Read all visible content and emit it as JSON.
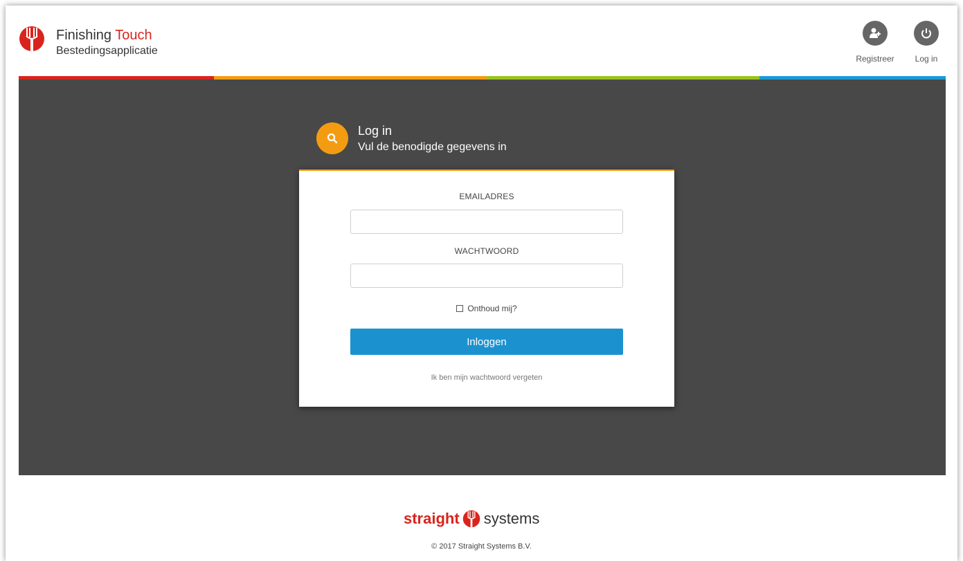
{
  "header": {
    "brand_title": "Finishing",
    "brand_title_accent": "Touch",
    "brand_subtitle": "Bestedingsapplicatie",
    "actions": [
      {
        "label": "Registreer",
        "icon": "add-user-icon"
      },
      {
        "label": "Log in",
        "icon": "power-icon"
      }
    ]
  },
  "stripe_colors": [
    "#d9241d",
    "#f39c12",
    "#9ac31c",
    "#1b9ad6"
  ],
  "panel": {
    "title": "Log in",
    "subtitle": "Vul de benodigde gegevens in",
    "icon": "search-icon",
    "icon_color": "#f39c12"
  },
  "form": {
    "email_label": "EMAILADRES",
    "email_value": "",
    "password_label": "WACHTWOORD",
    "password_value": "",
    "remember_label": "Onthoud mij?",
    "remember_checked": false,
    "submit_label": "Inloggen",
    "submit_color": "#1b92cf",
    "forgot_link": "Ik ben mijn wachtwoord vergeten"
  },
  "footer": {
    "logo_part1": "straight",
    "logo_part2": "systems",
    "copyright": "© 2017 Straight Systems B.V."
  }
}
